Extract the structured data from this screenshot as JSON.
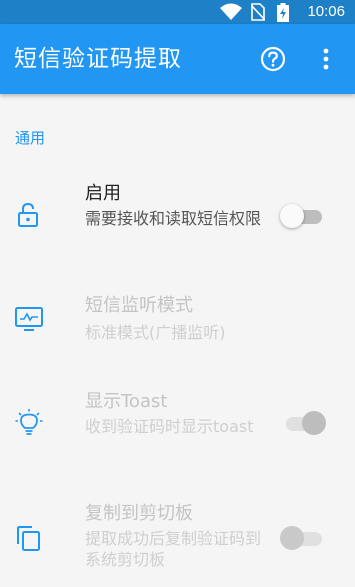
{
  "status_bar": {
    "time": "10:06"
  },
  "app_bar": {
    "title": "短信验证码提取",
    "help_icon": "help-circle-icon",
    "more_icon": "more-vert-icon"
  },
  "section": {
    "title": "通用"
  },
  "preferences": [
    {
      "title": "启用",
      "summary": "需要接收和读取短信权限",
      "icon": "lock-open-icon",
      "switch": "off",
      "enabled": true
    },
    {
      "title": "短信监听模式",
      "summary": "标准模式(广播监听)",
      "icon": "monitor-icon",
      "enabled": false
    },
    {
      "title": "显示Toast",
      "summary": "收到验证码时显示toast",
      "icon": "lightbulb-icon",
      "switch": "on",
      "enabled": false
    },
    {
      "title": "复制到剪切板",
      "summary": "提取成功后复制验证码到系统剪切板",
      "icon": "copy-icon",
      "switch": "off",
      "enabled": false
    }
  ],
  "colors": {
    "primary": "#2196f3",
    "primary_dark": "#1e80c6",
    "background": "#f5f5f5"
  }
}
